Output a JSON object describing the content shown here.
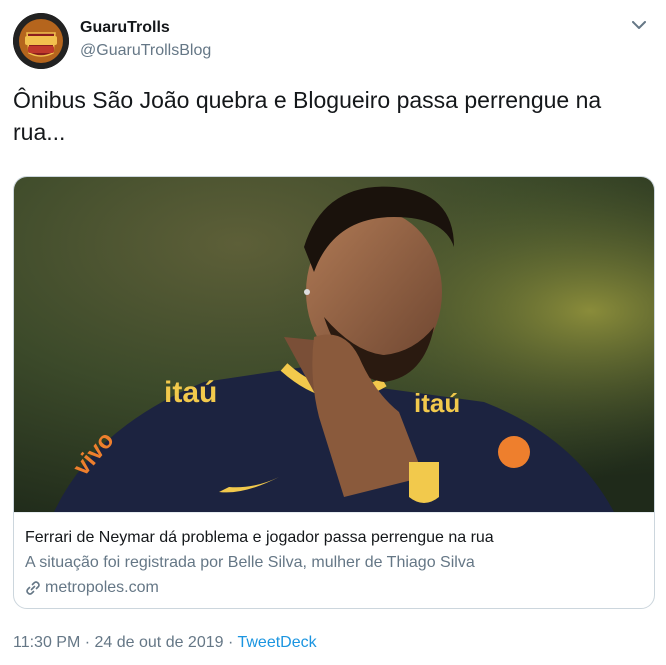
{
  "tweet": {
    "display_name": "GuaruTrolls",
    "handle": "@GuaruTrollsBlog",
    "text": "Ônibus São João quebra e Blogueiro passa perrengue na rua...",
    "avatar": {
      "badge_top": "GUARULHOS",
      "badge_mid": "GUARU",
      "badge_bottom": "TROLLS"
    }
  },
  "card": {
    "image_jersey_text": "itaú",
    "title": "Ferrari de Neymar dá problema e jogador passa perrengue na rua",
    "description": "A situação foi registrada por Belle Silva, mulher de Thiago Silva",
    "domain": "metropoles.com",
    "domain_icon": "link-icon"
  },
  "meta": {
    "time": "11:30 PM",
    "separator1": " · ",
    "date": "24 de out de 2019",
    "separator2": " · ",
    "source": "TweetDeck"
  },
  "colors": {
    "link": "#1b95e0",
    "secondary": "#657786",
    "border": "#ccd6dd"
  }
}
